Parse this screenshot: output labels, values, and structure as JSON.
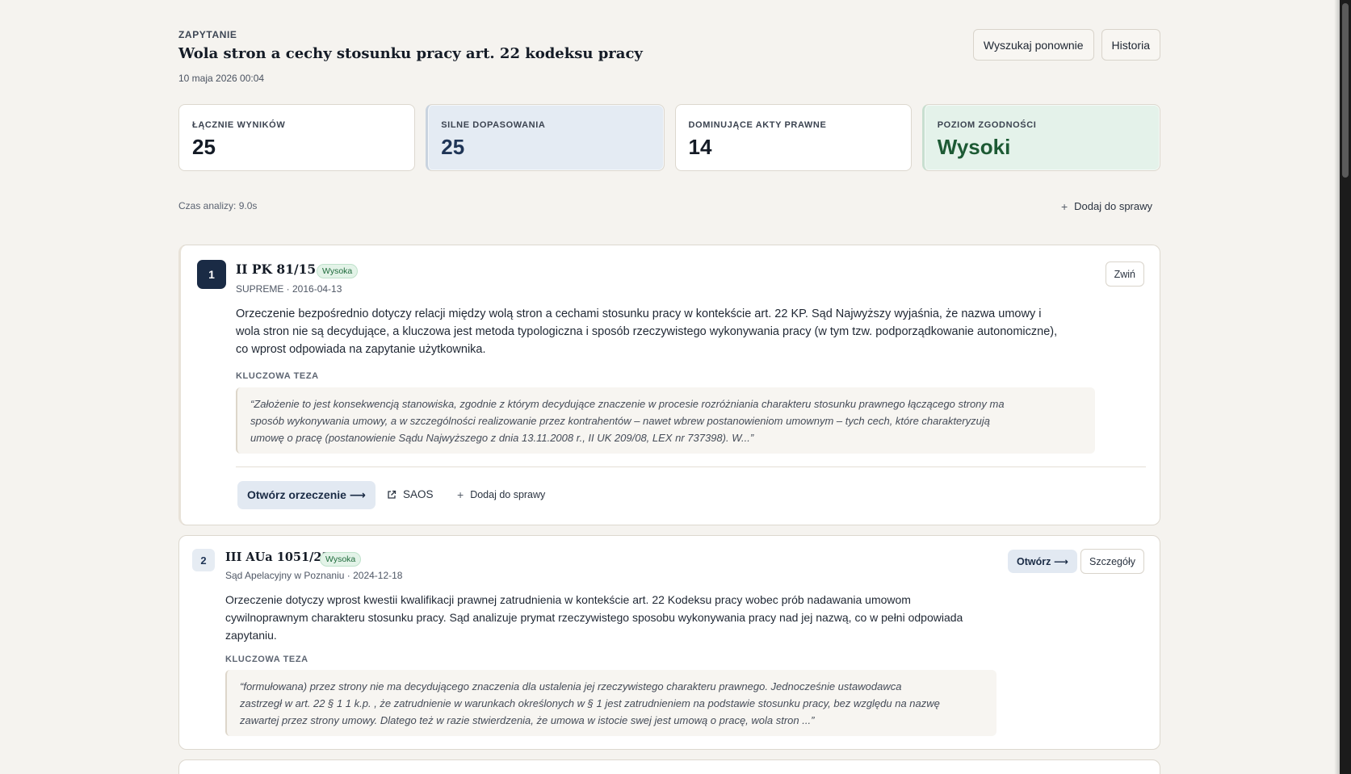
{
  "header": {
    "eyebrow": "ZAPYTANIE",
    "title": "Wola stron a cechy stosunku pracy art. 22 kodeksu pracy",
    "date": "10 maja 2026 00:04",
    "search_again_label": "Wyszukaj ponownie",
    "history_label": "Historia"
  },
  "stats": [
    {
      "label": "ŁĄCZNIE WYNIKÓW",
      "value": "25"
    },
    {
      "label": "SILNE DOPASOWANIA",
      "value": "25"
    },
    {
      "label": "DOMINUJĄCE AKTY PRAWNE",
      "value": "14"
    },
    {
      "label": "POZIOM ZGODNOŚCI",
      "value": "Wysoki"
    }
  ],
  "meta": {
    "analysis_time": "Czas analizy: 9.0s",
    "add_to_case": "Dodaj do sprawy"
  },
  "results": [
    {
      "rank": "1",
      "signature": "II PK 81/15",
      "badge": "Wysoka",
      "court_date": "SUPREME · 2016-04-13",
      "description_lines": [
        "Orzeczenie bezpośrednio dotyczy relacji między wolą stron a cechami stosunku pracy w kontekście art. 22 KP. Sąd Najwyższy wyjaśnia, że nazwa umowy i",
        "wola stron nie są decydujące, a kluczowa jest metoda typologiczna i sposób rzeczywistego wykonywania pracy (w tym tzw. podporządkowanie autonomiczne),",
        "co wprost odpowiada na zapytanie użytkownika."
      ],
      "key_thesis_label": "KLUCZOWA TEZA",
      "quote_lines": [
        "“Założenie to jest konsekwencją stanowiska, zgodnie z którym decydujące znaczenie w procesie rozróżniania charakteru stosunku prawnego łączącego strony ma",
        "sposób wykonywania umowy, a w szczególności realizowanie przez kontrahentów – nawet wbrew postanowieniom umownym – tych cech, które charakteryzują",
        "umowę o pracę (postanowienie Sądu Najwyższego z dnia 13.11.2008 r., II UK 209/08, LEX nr 737398). W...”"
      ],
      "collapse_label": "Zwiń",
      "open_label": "Otwórz orzeczenie ⟶",
      "saos_label": "SAOS",
      "add_label": "Dodaj do sprawy"
    },
    {
      "rank": "2",
      "signature": "III AUa 1051/23",
      "badge": "Wysoka",
      "court_date": "Sąd Apelacyjny w Poznaniu · 2024-12-18",
      "description_lines": [
        "Orzeczenie dotyczy wprost kwestii kwalifikacji prawnej zatrudnienia w kontekście art. 22 Kodeksu pracy wobec prób nadawania umowom",
        "cywilnoprawnym charakteru stosunku pracy. Sąd analizuje prymat rzeczywistego sposobu wykonywania pracy nad jej nazwą, co w pełni odpowiada",
        "zapytaniu."
      ],
      "key_thesis_label": "KLUCZOWA TEZA",
      "quote_lines": [
        "“formułowana) przez strony nie ma decydującego znaczenia dla ustalenia jej rzeczywistego charakteru prawnego. Jednocześnie ustawodawca",
        "zastrzegł w art. 22 § 1 1 k.p. , że zatrudnienie w warunkach określonych w § 1 jest zatrudnieniem na podstawie stosunku pracy, bez względu na nazwę",
        "zawartej przez strony umowy. Dlatego też w razie stwierdzenia, że umowa w istocie swej jest umową o pracę, wola stron ...”"
      ],
      "open_label": "Otwórz ⟶",
      "details_label": "Szczegóły"
    }
  ]
}
